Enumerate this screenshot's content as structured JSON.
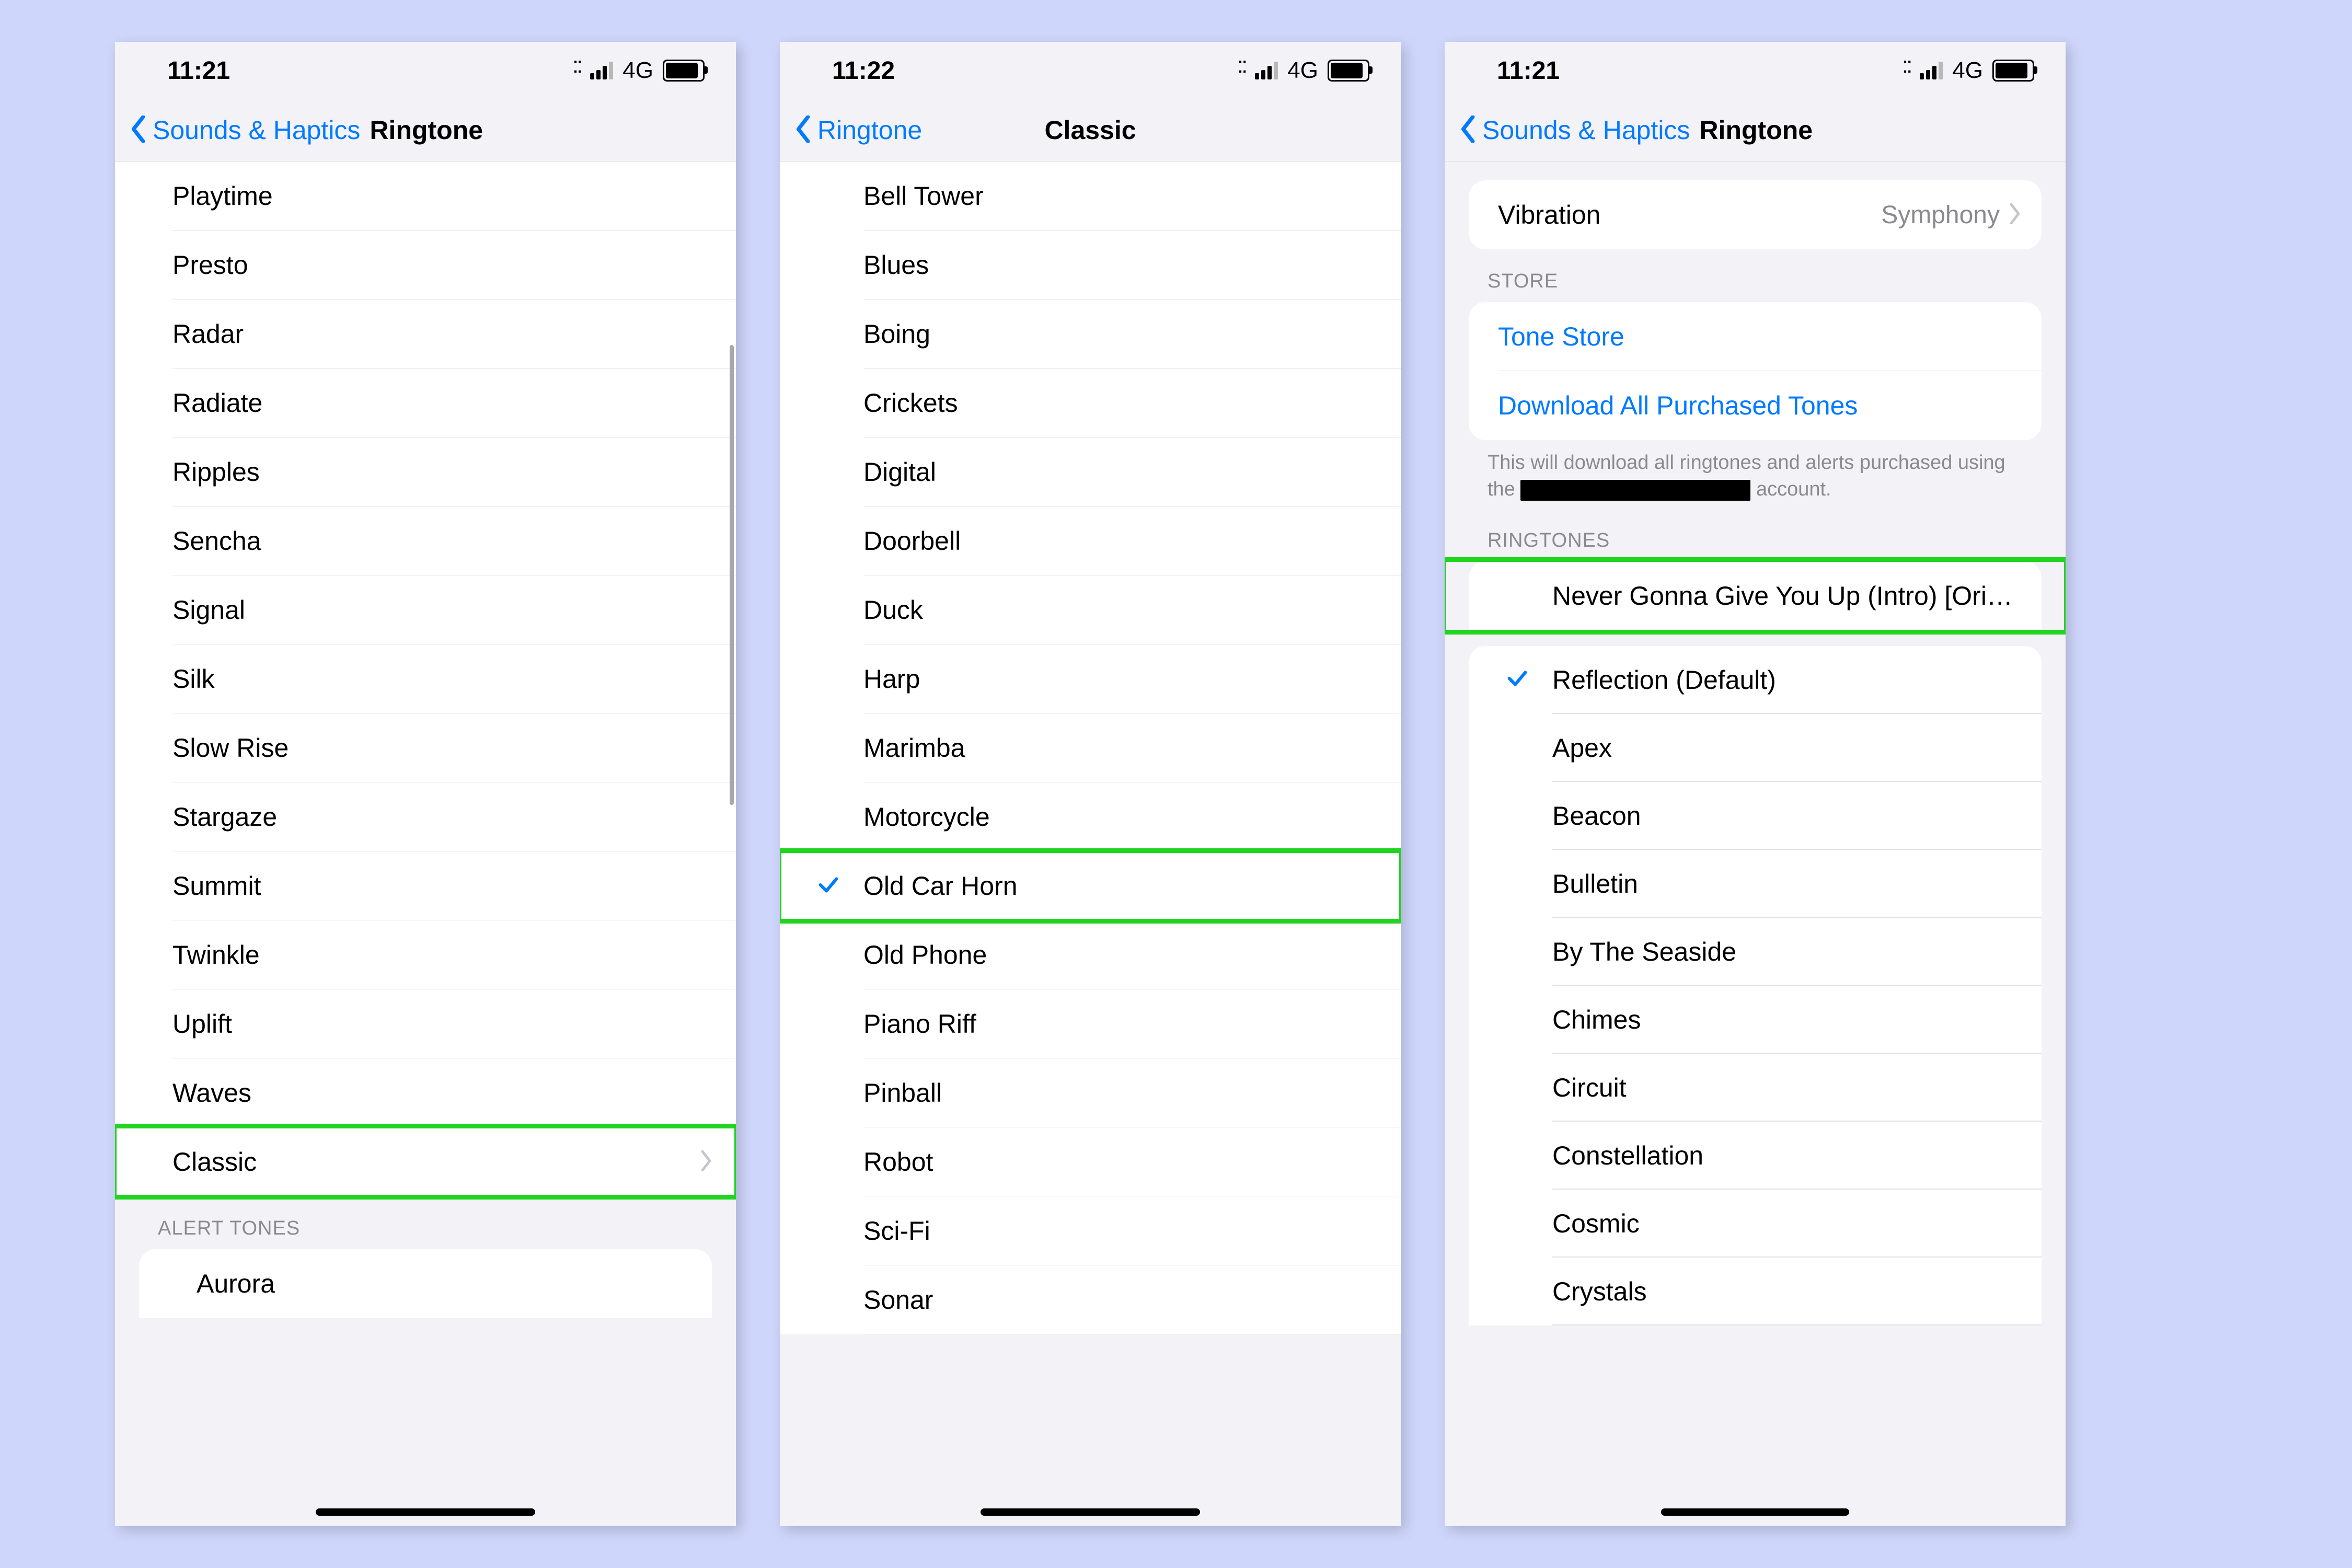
{
  "phone1": {
    "time": "11:21",
    "network": "4G",
    "back": "Sounds & Haptics",
    "title": "Ringtone",
    "ringtones": [
      "Playtime",
      "Presto",
      "Radar",
      "Radiate",
      "Ripples",
      "Sencha",
      "Signal",
      "Silk",
      "Slow Rise",
      "Stargaze",
      "Summit",
      "Twinkle",
      "Uplift",
      "Waves"
    ],
    "classic_row": "Classic",
    "alert_header": "ALERT TONES",
    "alert_items": [
      "Aurora"
    ]
  },
  "phone2": {
    "time": "11:22",
    "network": "4G",
    "back": "Ringtone",
    "title": "Classic",
    "items": [
      {
        "label": "Bell Tower",
        "checked": false
      },
      {
        "label": "Blues",
        "checked": false
      },
      {
        "label": "Boing",
        "checked": false
      },
      {
        "label": "Crickets",
        "checked": false
      },
      {
        "label": "Digital",
        "checked": false
      },
      {
        "label": "Doorbell",
        "checked": false
      },
      {
        "label": "Duck",
        "checked": false
      },
      {
        "label": "Harp",
        "checked": false
      },
      {
        "label": "Marimba",
        "checked": false
      },
      {
        "label": "Motorcycle",
        "checked": false
      },
      {
        "label": "Old Car Horn",
        "checked": true
      },
      {
        "label": "Old Phone",
        "checked": false
      },
      {
        "label": "Piano Riff",
        "checked": false
      },
      {
        "label": "Pinball",
        "checked": false
      },
      {
        "label": "Robot",
        "checked": false
      },
      {
        "label": "Sci-Fi",
        "checked": false
      },
      {
        "label": "Sonar",
        "checked": false
      }
    ]
  },
  "phone3": {
    "time": "11:21",
    "network": "4G",
    "back": "Sounds & Haptics",
    "title": "Ringtone",
    "vibration_label": "Vibration",
    "vibration_value": "Symphony",
    "store_header": "STORE",
    "store_items": [
      "Tone Store",
      "Download All Purchased Tones"
    ],
    "store_footer_a": "This will download all ringtones and alerts purchased using the",
    "store_footer_b": "account.",
    "ringtones_header": "RINGTONES",
    "custom_tone": "Never Gonna Give You Up (Intro) [Origi…",
    "ringtones": [
      {
        "label": "Reflection (Default)",
        "checked": true
      },
      {
        "label": "Apex",
        "checked": false
      },
      {
        "label": "Beacon",
        "checked": false
      },
      {
        "label": "Bulletin",
        "checked": false
      },
      {
        "label": "By The Seaside",
        "checked": false
      },
      {
        "label": "Chimes",
        "checked": false
      },
      {
        "label": "Circuit",
        "checked": false
      },
      {
        "label": "Constellation",
        "checked": false
      },
      {
        "label": "Cosmic",
        "checked": false
      },
      {
        "label": "Crystals",
        "checked": false
      }
    ]
  },
  "highlights": {
    "phone1_classic": true,
    "phone2_oldcarhorn": true,
    "phone3_custom": true
  }
}
